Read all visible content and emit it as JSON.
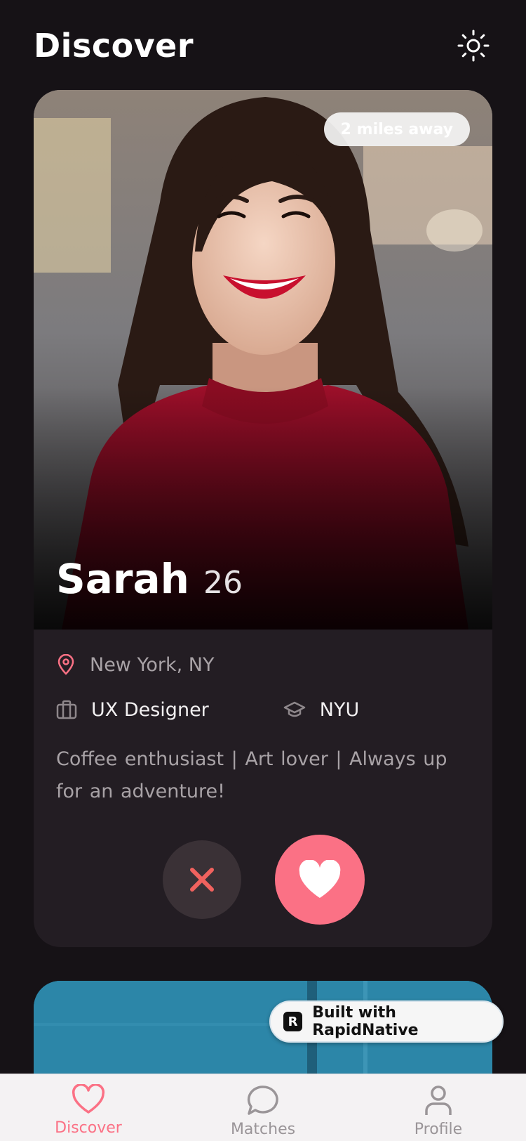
{
  "header": {
    "title": "Discover",
    "theme_toggle_icon": "sun-icon"
  },
  "card": {
    "distance": "2 miles away",
    "name": "Sarah",
    "age": "26",
    "location": "New York, NY",
    "job": "UX Designer",
    "school": "NYU",
    "bio": "Coffee enthusiast  | Art lover  | Always up for an adventure!",
    "icons": {
      "location": "map-pin-icon",
      "job": "briefcase-icon",
      "school": "graduation-cap-icon"
    },
    "actions": {
      "dislike_icon": "x-icon",
      "like_icon": "heart-icon"
    }
  },
  "badge": {
    "text": "Built with RapidNative",
    "logo": "R"
  },
  "tabs": [
    {
      "label": "Discover",
      "icon": "heart-icon",
      "active": true
    },
    {
      "label": "Matches",
      "icon": "chat-bubble-icon",
      "active": false
    },
    {
      "label": "Profile",
      "icon": "user-icon",
      "active": false
    }
  ],
  "colors": {
    "accent": "#fb7185",
    "background": "#161216",
    "card": "#231d23",
    "dislike_bg": "#3a3136",
    "dislike_icon": "#f0625e"
  }
}
